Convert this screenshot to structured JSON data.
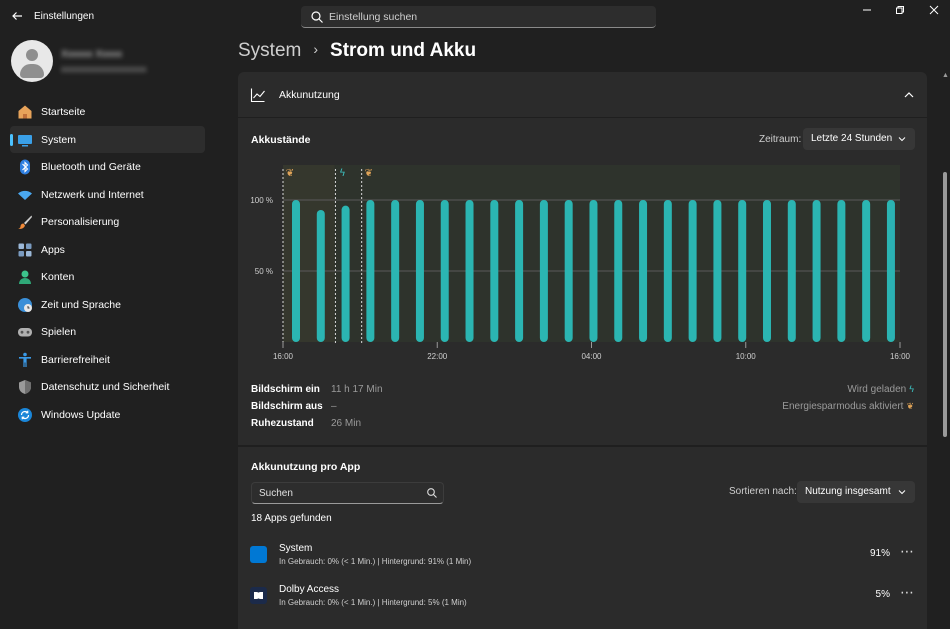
{
  "window": {
    "app_title": "Einstellungen",
    "search_placeholder": "Einstellung suchen"
  },
  "profile": {
    "name": "Xxxxxx Xxxxx",
    "email": "xxxxxxxxxxxxxxxxxxx"
  },
  "sidebar": {
    "items": [
      {
        "label": "Startseite",
        "icon": "home-icon"
      },
      {
        "label": "System",
        "icon": "system-icon",
        "active": true
      },
      {
        "label": "Bluetooth und Geräte",
        "icon": "bluetooth-icon"
      },
      {
        "label": "Netzwerk und Internet",
        "icon": "network-icon"
      },
      {
        "label": "Personalisierung",
        "icon": "brush-icon"
      },
      {
        "label": "Apps",
        "icon": "apps-icon"
      },
      {
        "label": "Konten",
        "icon": "accounts-icon"
      },
      {
        "label": "Zeit und Sprache",
        "icon": "globe-clock-icon"
      },
      {
        "label": "Spielen",
        "icon": "gamepad-icon"
      },
      {
        "label": "Barrierefreiheit",
        "icon": "accessibility-icon"
      },
      {
        "label": "Datenschutz und Sicherheit",
        "icon": "shield-icon"
      },
      {
        "label": "Windows Update",
        "icon": "update-icon"
      }
    ]
  },
  "breadcrumb": {
    "parent": "System",
    "separator": "›",
    "current": "Strom und Akku"
  },
  "usage_panel": {
    "title": "Akkunutzung",
    "levels_title": "Akkustände",
    "period_label": "Zeitraum:",
    "period_value": "Letzte 24 Stunden"
  },
  "chart_data": {
    "type": "bar",
    "title": "Akkustände",
    "ylim": [
      0,
      100
    ],
    "y_ticks": [
      "100 %",
      "50 %"
    ],
    "y_tick_values": [
      100,
      50
    ],
    "x_tick_labels": [
      "16:00",
      "22:00",
      "04:00",
      "10:00",
      "16:00"
    ],
    "hours": [
      16,
      17,
      18,
      19,
      20,
      21,
      22,
      23,
      0,
      1,
      2,
      3,
      4,
      5,
      6,
      7,
      8,
      9,
      10,
      11,
      12,
      13,
      14,
      15,
      16
    ],
    "values": [
      100,
      93,
      96,
      100,
      100,
      100,
      100,
      100,
      100,
      100,
      100,
      100,
      100,
      100,
      100,
      100,
      100,
      100,
      100,
      100,
      100,
      100,
      100,
      100,
      100
    ],
    "markers": [
      {
        "hour_index": 0,
        "type": "energy-saver"
      },
      {
        "hour_index": 2,
        "type": "charging"
      },
      {
        "hour_index": 3,
        "type": "energy-saver"
      }
    ],
    "bar_color": "#2bb5b2",
    "energy_saver_color": "#e0a458",
    "charging_color": "#3ec6c6",
    "grid": true
  },
  "stats": {
    "rows": [
      {
        "label": "Bildschirm ein",
        "value": "11 h 17 Min"
      },
      {
        "label": "Bildschirm aus",
        "value": "–"
      },
      {
        "label": "Ruhezustand",
        "value": "26 Min"
      }
    ],
    "legend": [
      {
        "label": "Wird geladen",
        "icon": "charging-icon"
      },
      {
        "label": "Energiesparmodus aktiviert",
        "icon": "leaf-icon"
      }
    ]
  },
  "app_usage": {
    "title": "Akkunutzung pro App",
    "search_placeholder": "Suchen",
    "sort_label": "Sortieren nach:",
    "sort_value": "Nutzung insgesamt",
    "found": "18 Apps gefunden",
    "apps": [
      {
        "name": "System",
        "detail": "In Gebrauch: 0% (< 1 Min.) | Hintergrund: 91% (1 Min)",
        "percent": "91%",
        "icon_color": "#0078d4"
      },
      {
        "name": "Dolby Access",
        "detail": "In Gebrauch: 0% (< 1 Min.) | Hintergrund: 5% (1 Min)",
        "percent": "5%",
        "icon_color": "#1b2a4a"
      }
    ]
  }
}
